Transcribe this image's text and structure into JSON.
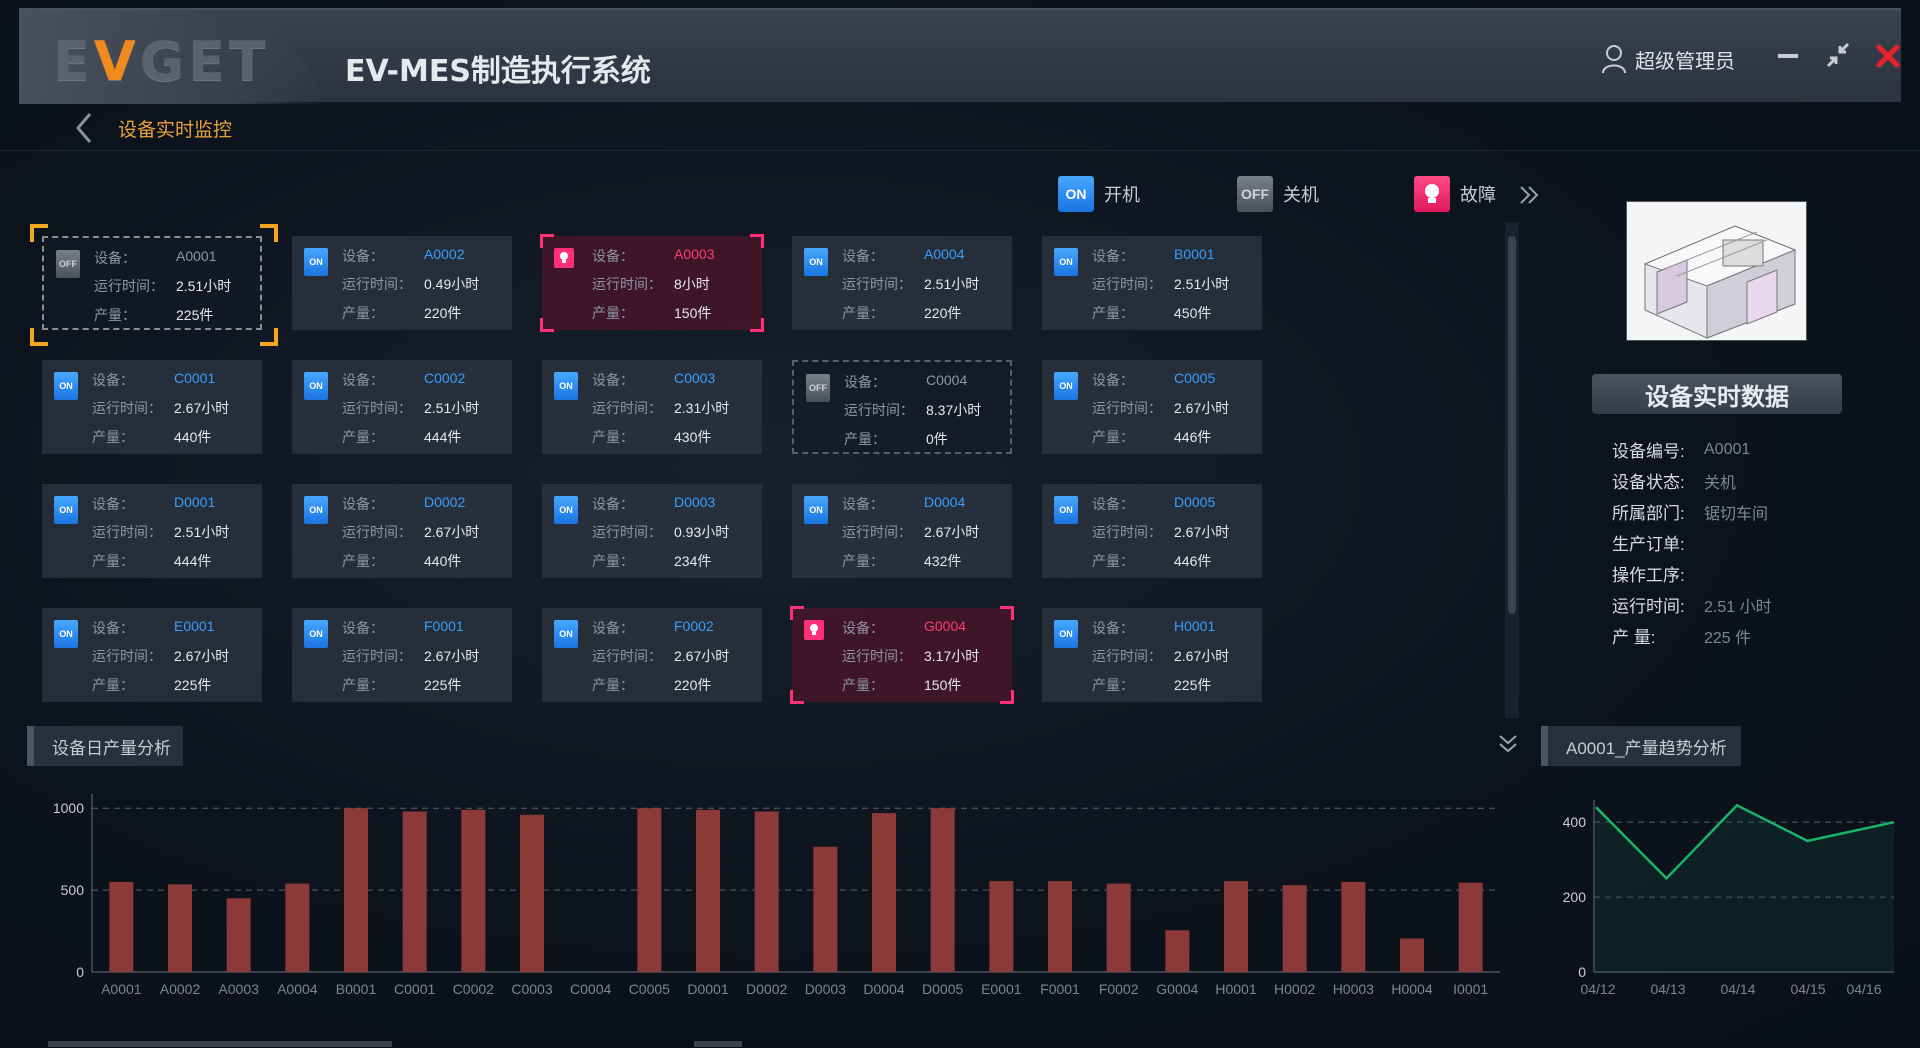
{
  "app": {
    "logo": "EVGET",
    "title": "EV-MES制造执行系统",
    "user": "超级管理员"
  },
  "breadcrumb": {
    "title": "设备实时监控"
  },
  "legend": {
    "on": {
      "icon": "ON",
      "label": "开机"
    },
    "off": {
      "icon": "OFF",
      "label": "关机"
    },
    "fault": {
      "label": "故障"
    }
  },
  "labels": {
    "device": "设备：",
    "runtime": "运行时间：",
    "output": "产量："
  },
  "devices": [
    {
      "id": "A0001",
      "status": "OFF",
      "runtime": "2.51小时",
      "output": "225件"
    },
    {
      "id": "A0002",
      "status": "ON",
      "runtime": "0.49小时",
      "output": "220件"
    },
    {
      "id": "A0003",
      "status": "FAULT",
      "runtime": "8小时",
      "output": "150件"
    },
    {
      "id": "A0004",
      "status": "ON",
      "runtime": "2.51小时",
      "output": "220件"
    },
    {
      "id": "B0001",
      "status": "ON",
      "runtime": "2.51小时",
      "output": "450件"
    },
    {
      "id": "C0001",
      "status": "ON",
      "runtime": "2.67小时",
      "output": "440件"
    },
    {
      "id": "C0002",
      "status": "ON",
      "runtime": "2.51小时",
      "output": "444件"
    },
    {
      "id": "C0003",
      "status": "ON",
      "runtime": "2.31小时",
      "output": "430件"
    },
    {
      "id": "C0004",
      "status": "OFF",
      "runtime": "8.37小时",
      "output": "0件"
    },
    {
      "id": "C0005",
      "status": "ON",
      "runtime": "2.67小时",
      "output": "446件"
    },
    {
      "id": "D0001",
      "status": "ON",
      "runtime": "2.51小时",
      "output": "444件"
    },
    {
      "id": "D0002",
      "status": "ON",
      "runtime": "2.67小时",
      "output": "440件"
    },
    {
      "id": "D0003",
      "status": "ON",
      "runtime": "0.93小时",
      "output": "234件"
    },
    {
      "id": "D0004",
      "status": "ON",
      "runtime": "2.67小时",
      "output": "432件"
    },
    {
      "id": "D0005",
      "status": "ON",
      "runtime": "2.67小时",
      "output": "446件"
    },
    {
      "id": "E0001",
      "status": "ON",
      "runtime": "2.67小时",
      "output": "225件"
    },
    {
      "id": "F0001",
      "status": "ON",
      "runtime": "2.67小时",
      "output": "225件"
    },
    {
      "id": "F0002",
      "status": "ON",
      "runtime": "2.67小时",
      "output": "220件"
    },
    {
      "id": "G0004",
      "status": "FAULT",
      "runtime": "3.17小时",
      "output": "150件"
    },
    {
      "id": "H0001",
      "status": "ON",
      "runtime": "2.67小时",
      "output": "225件"
    }
  ],
  "selected_device": "A0001",
  "realtime": {
    "title": "设备实时数据",
    "rows": [
      {
        "label": "设备编号:",
        "value": "A0001"
      },
      {
        "label": "设备状态:",
        "value": "关机"
      },
      {
        "label": "所属部门:",
        "value": "锯切车间"
      },
      {
        "label": "生产订单:",
        "value": ""
      },
      {
        "label": "操作工序:",
        "value": ""
      },
      {
        "label": "运行时间:",
        "value": "2.51  小时"
      },
      {
        "label": "产      量:",
        "value": "225  件"
      }
    ]
  },
  "sections": {
    "daily": "设备日产量分析",
    "trend": "A0001_产量趋势分析"
  },
  "colors": {
    "on": "#2a8cf4",
    "off": "#6b7179",
    "fault": "#ff2f78",
    "bar": "#8b3a38",
    "trend_line": "#19b36a",
    "accent": "#f4a623"
  },
  "chart_data": [
    {
      "type": "bar",
      "title": "设备日产量分析",
      "categories": [
        "A0001",
        "A0002",
        "A0003",
        "A0004",
        "B0001",
        "C0001",
        "C0002",
        "C0003",
        "C0004",
        "C0005",
        "D0001",
        "D0002",
        "D0003",
        "D0004",
        "D0005",
        "E0001",
        "F0001",
        "F0002",
        "G0004",
        "H0001",
        "H0002",
        "H0003",
        "H0004",
        "I0001"
      ],
      "values": [
        550,
        535,
        450,
        540,
        1000,
        980,
        990,
        960,
        0,
        1000,
        990,
        980,
        765,
        970,
        1000,
        555,
        555,
        540,
        255,
        555,
        530,
        550,
        205,
        545
      ],
      "yticks": [
        0,
        500,
        1000
      ],
      "ylim": [
        0,
        1050
      ],
      "grid": true
    },
    {
      "type": "area",
      "title": "A0001_产量趋势分析",
      "x": [
        "04/12",
        "04/13",
        "04/14",
        "04/15",
        "04/16"
      ],
      "values": [
        440,
        250,
        445,
        350,
        400
      ],
      "yticks": [
        0,
        200,
        400
      ],
      "ylim": [
        0,
        450
      ],
      "grid": true
    }
  ]
}
